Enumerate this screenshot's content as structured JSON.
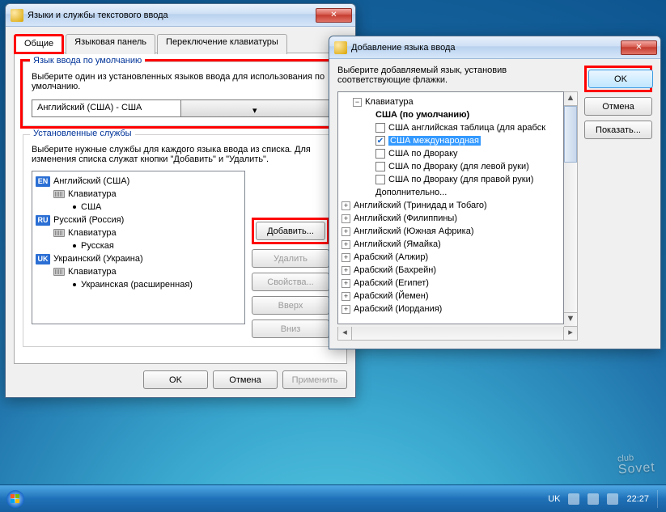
{
  "main": {
    "title": "Языки и службы текстового ввода",
    "tabs": [
      "Общие",
      "Языковая панель",
      "Переключение клавиатуры"
    ],
    "default_group_legend": "Язык ввода по умолчанию",
    "default_group_text": "Выберите один из установленных языков ввода для использования по умолчанию.",
    "default_combo_value": "Английский (США) - США",
    "installed_legend": "Установленные службы",
    "installed_text": "Выберите нужные службы для каждого языка ввода из списка. Для изменения списка служат кнопки \"Добавить\" и \"Удалить\".",
    "langs": [
      {
        "badge": "EN",
        "color": "#2b6fd4",
        "name": "Английский (США)",
        "kb_label": "Клавиатура",
        "layout": "США"
      },
      {
        "badge": "RU",
        "color": "#2b6fd4",
        "name": "Русский (Россия)",
        "kb_label": "Клавиатура",
        "layout": "Русская"
      },
      {
        "badge": "UK",
        "color": "#2b6fd4",
        "name": "Украинский (Украина)",
        "kb_label": "Клавиатура",
        "layout": "Украинская (расширенная)"
      }
    ],
    "side_buttons": {
      "add": "Добавить...",
      "remove": "Удалить",
      "props": "Свойства...",
      "up": "Вверх",
      "down": "Вниз"
    },
    "bottom": {
      "ok": "OK",
      "cancel": "Отмена",
      "apply": "Применить"
    }
  },
  "add": {
    "title": "Добавление языка ввода",
    "instr": "Выберите добавляемый язык, установив соответствующие флажки.",
    "kb_root": "Клавиатура",
    "kb_default": "США (по умолчанию)",
    "kb_items": [
      {
        "label": "США английская таблица (для арабск",
        "checked": false
      },
      {
        "label": "США международная",
        "checked": true,
        "selected": true
      },
      {
        "label": "США по Двораку",
        "checked": false
      },
      {
        "label": "США по Двораку (для левой руки)",
        "checked": false
      },
      {
        "label": "США по Двораку (для правой руки)",
        "checked": false
      }
    ],
    "kb_more": "Дополнительно...",
    "langs": [
      "Английский (Тринидад и Тобаго)",
      "Английский (Филиппины)",
      "Английский (Южная Африка)",
      "Английский (Ямайка)",
      "Арабский (Алжир)",
      "Арабский (Бахрейн)",
      "Арабский (Египет)",
      "Арабский (Йемен)",
      "Арабский (Иордания)"
    ],
    "buttons": {
      "ok": "OK",
      "cancel": "Отмена",
      "preview": "Показать..."
    }
  },
  "taskbar": {
    "lang": "UK",
    "time": "22:27"
  },
  "watermark": {
    "top": "club",
    "bottom": "Sovet"
  }
}
